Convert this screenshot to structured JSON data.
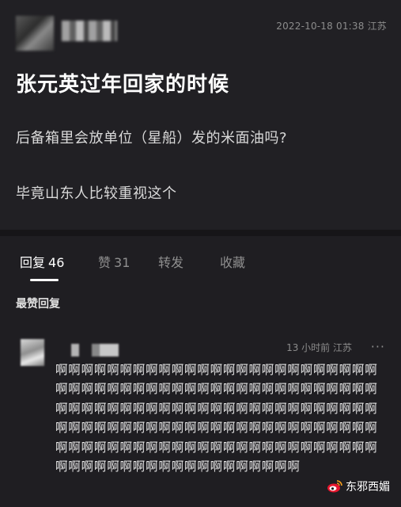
{
  "post": {
    "timestamp": "2022-10-18 01:38",
    "location": "江苏",
    "title": "张元英过年回家的时候",
    "lines": [
      "后备箱里会放单位（星船）发的米面油吗?",
      "毕竟山东人比较重视这个"
    ]
  },
  "tabs": [
    {
      "label": "回复",
      "count": "46",
      "active": true
    },
    {
      "label": "赞",
      "count": "31",
      "active": false
    },
    {
      "label": "转发",
      "count": "",
      "active": false
    },
    {
      "label": "收藏",
      "count": "",
      "active": false
    }
  ],
  "section": {
    "title": "最赞回复"
  },
  "comment": {
    "time": "13 小时前",
    "location": "江苏",
    "text": "啊啊啊啊啊啊啊啊啊啊啊啊啊啊啊啊啊啊啊啊啊啊啊啊啊啊啊啊啊啊啊啊啊啊啊啊啊啊啊啊啊啊啊啊啊啊啊啊啊啊啊啊啊啊啊啊啊啊啊啊啊啊啊啊啊啊啊啊啊啊啊啊啊啊啊啊啊啊啊啊啊啊啊啊啊啊啊啊啊啊啊啊啊啊啊啊啊啊啊啊啊啊啊啊啊啊啊啊啊啊啊啊啊啊啊啊啊啊啊啊啊啊啊啊啊啊啊啊啊啊啊啊啊啊啊啊啊啊啊啊啊啊啊啊"
  },
  "more_icon": "···",
  "watermark": {
    "icon": "weibo-icon",
    "text": "东邪西媚"
  }
}
